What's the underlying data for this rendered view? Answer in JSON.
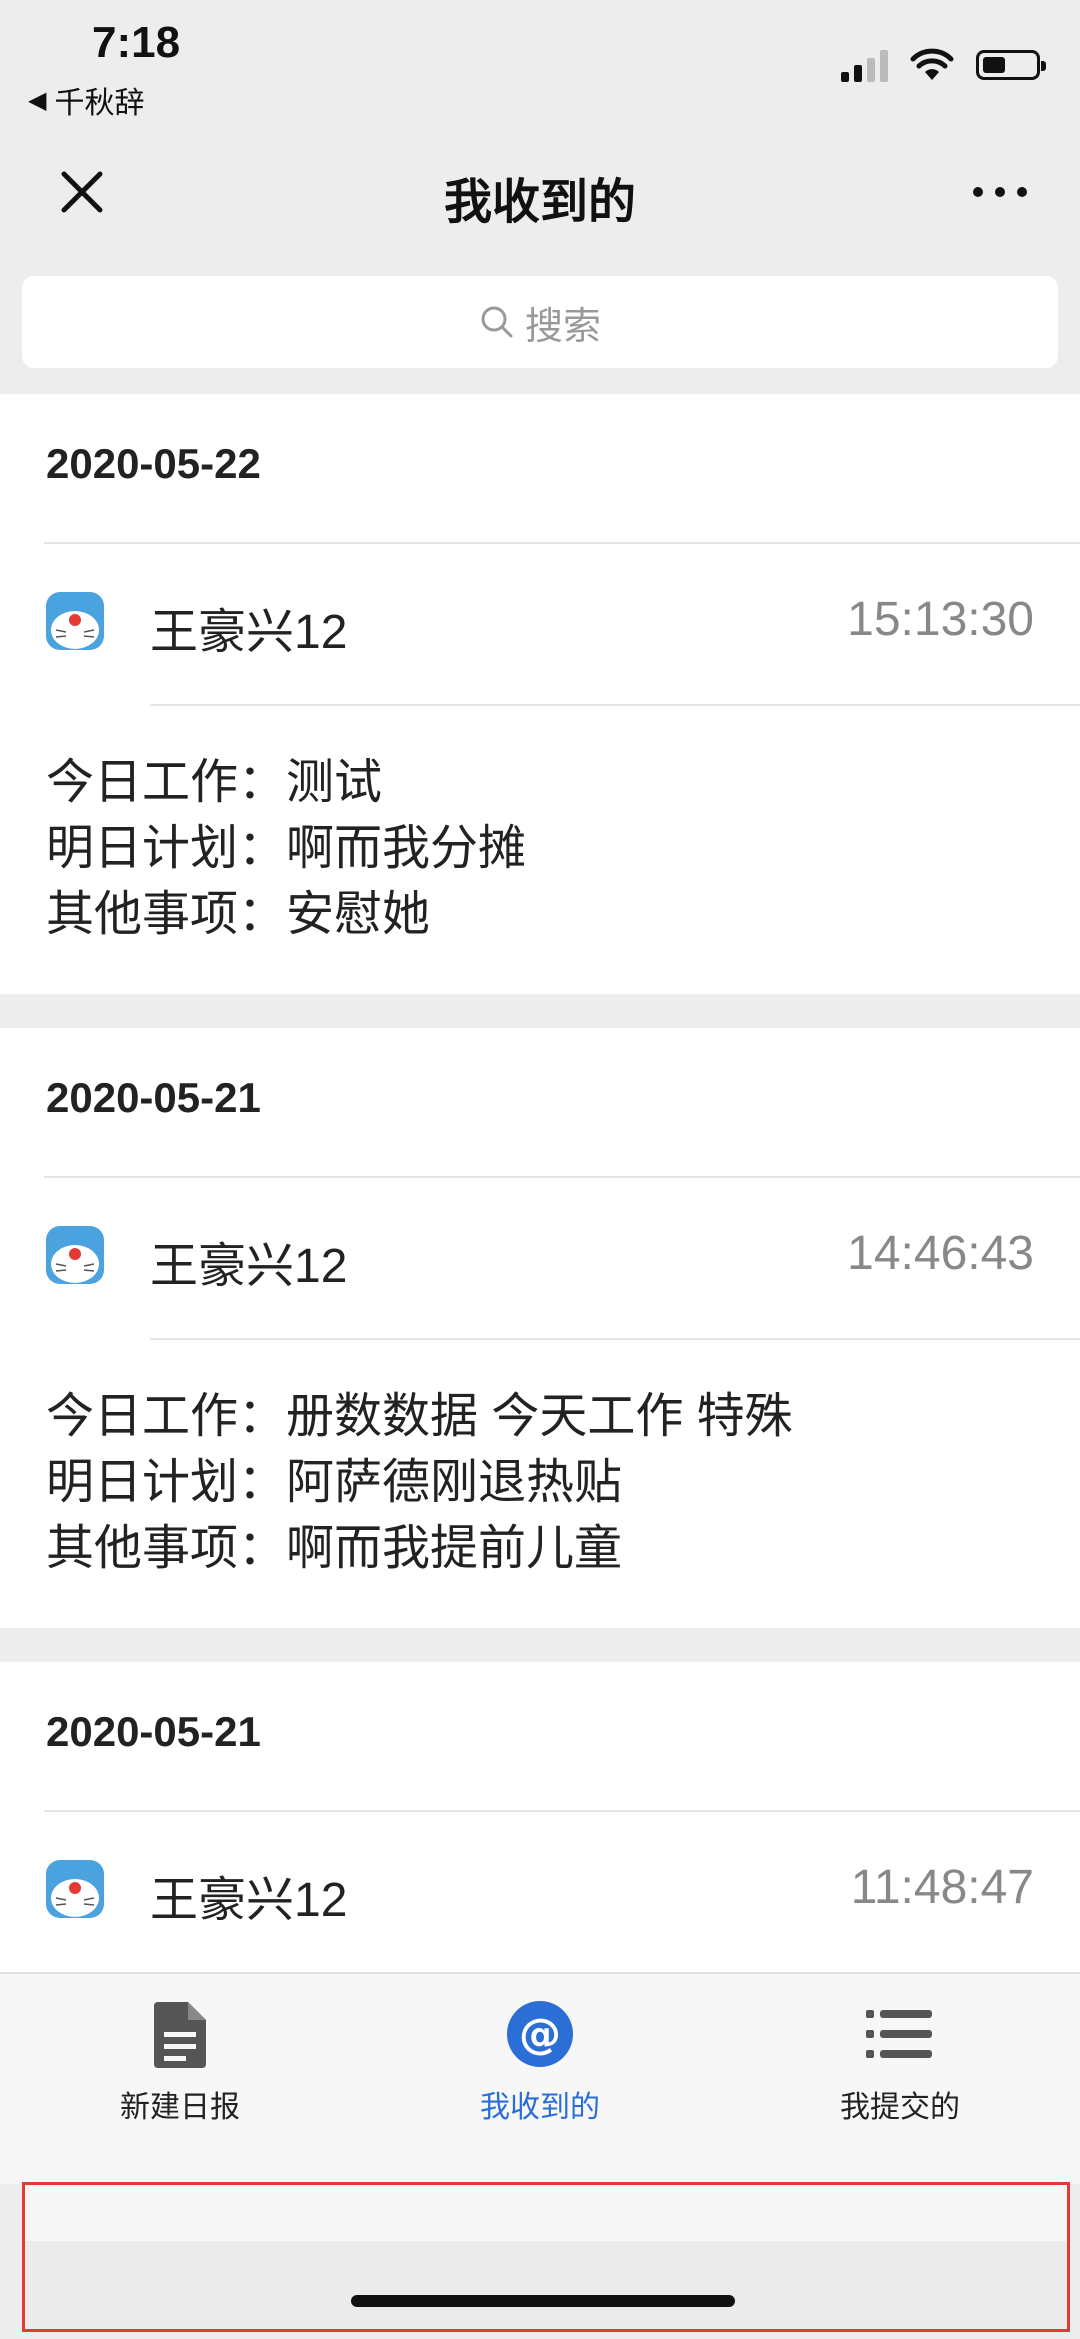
{
  "status": {
    "time": "7:18",
    "back_label": "千秋辞"
  },
  "nav": {
    "title": "我收到的"
  },
  "search": {
    "placeholder": "搜索"
  },
  "reports": [
    {
      "date": "2020-05-22",
      "name": "王豪兴12",
      "time": "15:13:30",
      "lines": [
        "今日工作：测试",
        "明日计划：啊而我分摊",
        "其他事项：安慰她"
      ]
    },
    {
      "date": "2020-05-21",
      "name": "王豪兴12",
      "time": "14:46:43",
      "lines": [
        "今日工作：册数数据 今天工作 特殊",
        "明日计划：阿萨德刚退热贴",
        "其他事项：啊而我提前儿童"
      ]
    },
    {
      "date": "2020-05-21",
      "name": "王豪兴12",
      "time": "11:48:47"
    }
  ],
  "tabs": [
    {
      "label": "新建日报",
      "icon": "document-icon"
    },
    {
      "label": "我收到的",
      "icon": "at-icon",
      "active": true
    },
    {
      "label": "我提交的",
      "icon": "list-icon"
    }
  ],
  "colors": {
    "accent": "#2b6fd6",
    "highlight_border": "#e53935"
  }
}
